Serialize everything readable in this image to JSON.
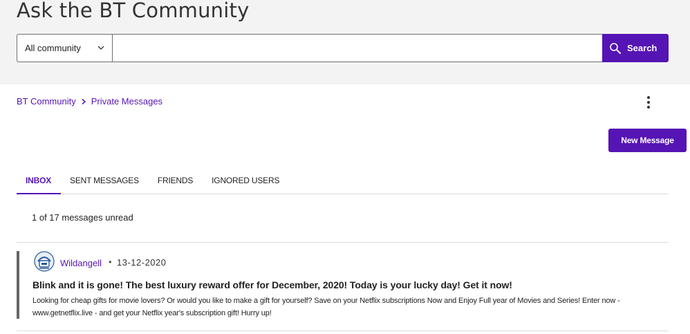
{
  "hero": {
    "title": "Ask the BT Community"
  },
  "search": {
    "scope_value": "All community",
    "input_value": "",
    "button_label": "Search"
  },
  "breadcrumb": {
    "items": [
      "BT Community",
      "Private Messages"
    ]
  },
  "actions": {
    "new_message_label": "New Message"
  },
  "tabs": [
    {
      "label": "INBOX",
      "active": true
    },
    {
      "label": "SENT MESSAGES",
      "active": false
    },
    {
      "label": "FRIENDS",
      "active": false
    },
    {
      "label": "IGNORED USERS",
      "active": false
    }
  ],
  "inbox": {
    "unread_text": "1 of 17 messages unread",
    "messages": [
      {
        "author": "Wildangell",
        "separator": "•",
        "date": "13-12-2020",
        "subject": "Blink and it is gone! The best luxury reward offer for December, 2020! Today is your lucky day! Get it now!",
        "snippet": "Looking for cheap gifts for movie lovers? Or would you like to make a gift for yourself? Save on your Netflix subscriptions Now and Enjoy Full year of Movies and Series! Enter now - www.getnetflix.live - and get your Netflix year's subscription gift! Hurry up!"
      }
    ]
  },
  "colors": {
    "brand_purple": "#5514b4",
    "hero_bg": "#f3f3f3",
    "unread_bar": "#666666"
  },
  "icons": [
    "chevron-down-icon",
    "search-icon",
    "chevron-right-icon",
    "more-vertical-icon",
    "avatar-icon"
  ]
}
